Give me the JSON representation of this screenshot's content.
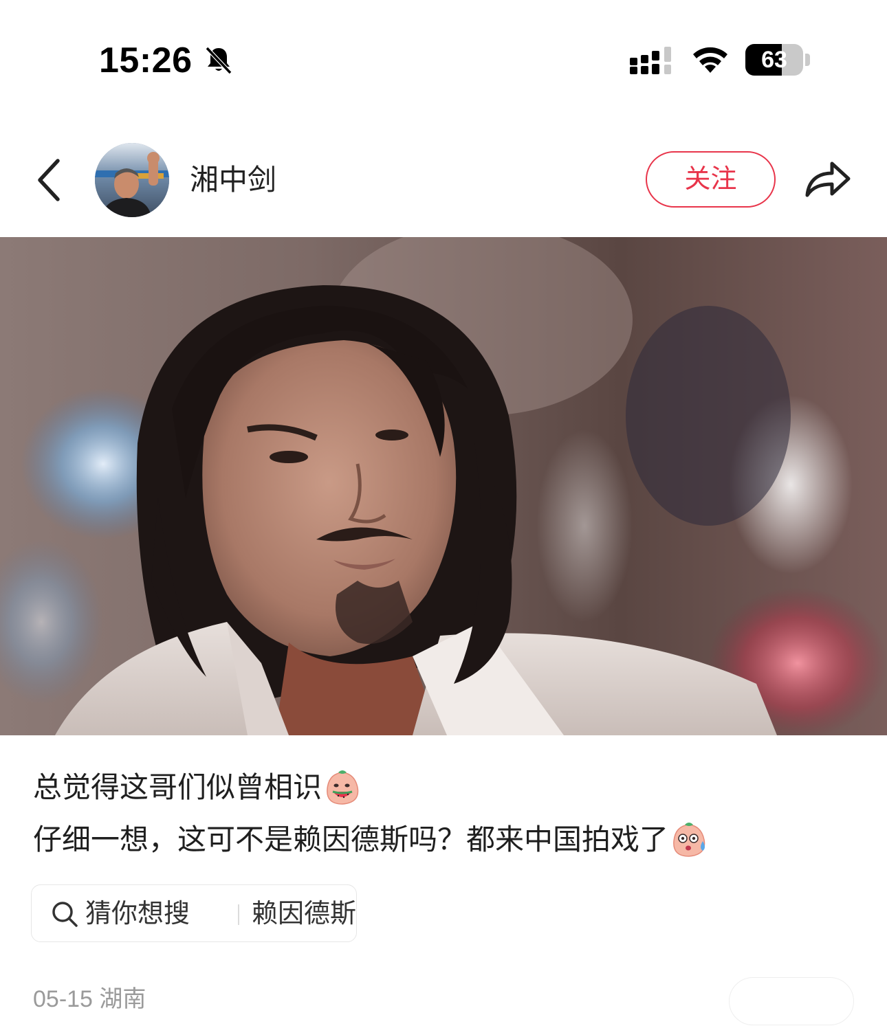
{
  "status_bar": {
    "time": "15:26",
    "battery_text": "63",
    "battery_level": 0.63,
    "icons": [
      "bell-muted-icon",
      "cellular-signal-icon",
      "wifi-icon",
      "battery-icon"
    ]
  },
  "header": {
    "username": "湘中剑",
    "follow_label": "关注",
    "icons": [
      "back-chevron-icon",
      "share-icon"
    ],
    "accent_color": "#e8344a"
  },
  "post": {
    "caption_line_1": "总觉得这哥们似曾相识",
    "caption_line_2": "仔细一想，这可不是赖因德斯吗？都来中国拍戏了",
    "emoji_1": "watermelon-eating-emoji",
    "emoji_2": "sweating-surprised-emoji"
  },
  "search_suggestion": {
    "prefix": "猜你想搜",
    "term": "赖因德斯"
  },
  "meta": {
    "date_location": "05-15 湖南"
  }
}
